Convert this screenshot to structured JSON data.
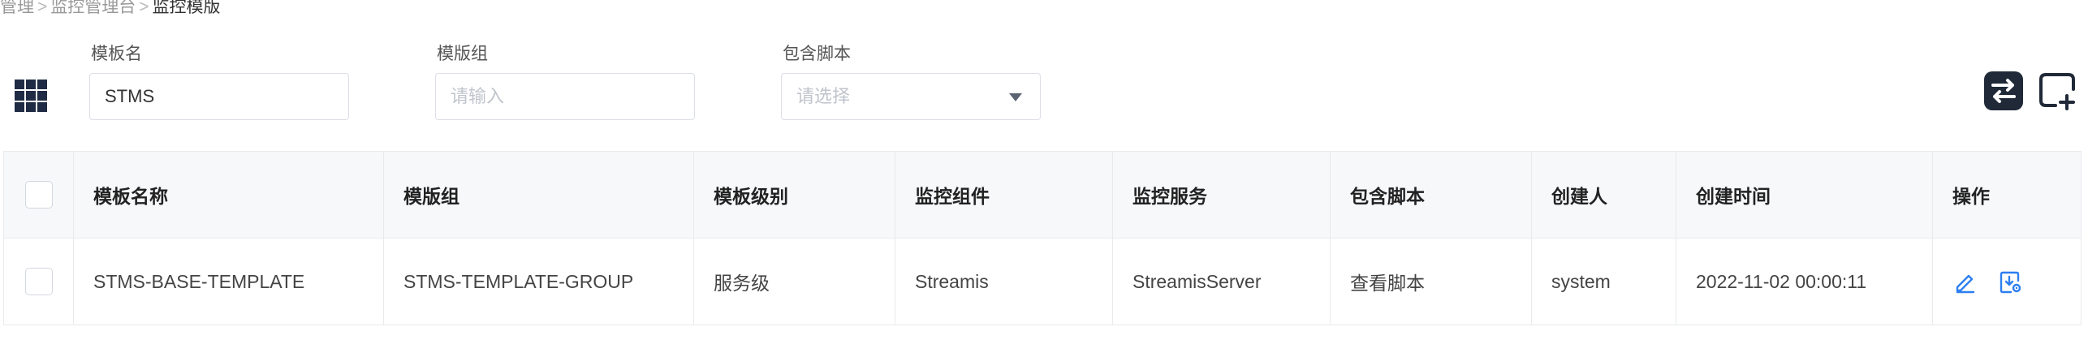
{
  "breadcrumb": {
    "items": [
      "管理",
      "监控管理台",
      "监控模版"
    ],
    "separator": ">"
  },
  "filters": {
    "template_name": {
      "label": "模板名",
      "value": "STMS",
      "placeholder": ""
    },
    "template_group": {
      "label": "模版组",
      "value": "",
      "placeholder": "请输入"
    },
    "include_script": {
      "label": "包含脚本",
      "placeholder": "请选择",
      "icon": "caret-down-icon"
    }
  },
  "toolbar": {
    "left_icon": "grid-view-icon",
    "switch_icon": "switch-icon",
    "add_icon": "add-template-icon",
    "accent_color": "#1f2937"
  },
  "table": {
    "headers": {
      "template_name": "模板名称",
      "template_group": "模版组",
      "level": "模板级别",
      "component": "监控组件",
      "service": "监控服务",
      "script": "包含脚本",
      "creator": "创建人",
      "created_at": "创建时间",
      "actions": "操作"
    },
    "rows": [
      {
        "template_name": "STMS-BASE-TEMPLATE",
        "template_group": "STMS-TEMPLATE-GROUP",
        "level": "服务级",
        "component": "Streamis",
        "service": "StreamisServer",
        "script": "查看脚本",
        "creator": "system",
        "created_at": "2022-11-02 00:00:11",
        "actions": [
          "edit-icon",
          "export-config-icon"
        ]
      }
    ],
    "link_color": "#2d7ff0"
  }
}
